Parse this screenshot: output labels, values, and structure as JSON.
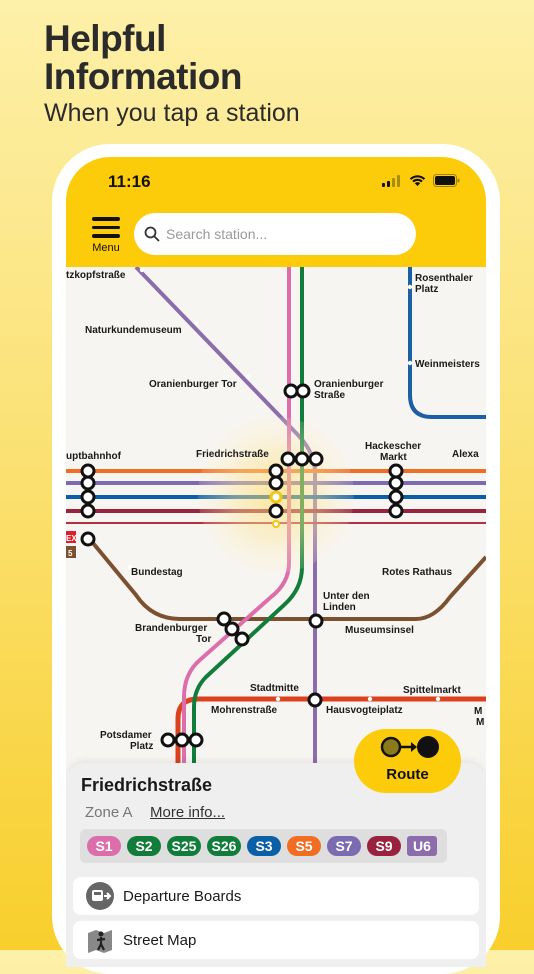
{
  "headline": {
    "line1": "Helpful",
    "line2": "Information",
    "sub": "When you tap a station"
  },
  "status": {
    "time": "11:16"
  },
  "appbar": {
    "menu_label": "Menu",
    "search_placeholder": "Search station..."
  },
  "map": {
    "stations": {
      "kopf": "tzkopfstraße",
      "natur": "Naturkundemuseum",
      "oranTor": "Oranienburger Tor",
      "oranStr1": "Oranienburger",
      "oranStr2": "Straße",
      "rosen1": "Rosenthaler",
      "rosen2": "Platz",
      "weinm": "Weinmeisters",
      "friedrich": "Friedrichstraße",
      "hack1": "Hackescher",
      "hack2": "Markt",
      "alex": "Alexa",
      "hbf": "uptbahnhof",
      "bundestag": "Bundestag",
      "rotes": "Rotes Rathaus",
      "unter1": "Unter den",
      "unter2": "Linden",
      "museum": "Museumsinsel",
      "brand1": "Brandenburger",
      "brand2": "Tor",
      "stadt": "Stadtmitte",
      "spittel": "Spittelmarkt",
      "mohren": "Mohrenstraße",
      "hausvogt": "Hausvogteiplatz",
      "pots1": "Potsdamer",
      "pots2": "Platz",
      "edge1": "M",
      "edge2": "M",
      "ex": "EX",
      "five": "5"
    }
  },
  "route": {
    "label": "Route"
  },
  "sheet": {
    "name": "Friedrichstraße",
    "zone": "Zone A",
    "more": "More info...",
    "lines": [
      {
        "label": "S1",
        "color": "#db6eab",
        "w": 34
      },
      {
        "label": "S2",
        "color": "#127d3a",
        "w": 34
      },
      {
        "label": "S25",
        "color": "#127d3a",
        "w": 34
      },
      {
        "label": "S26",
        "color": "#127d3a",
        "w": 34
      },
      {
        "label": "S3",
        "color": "#0a5fa6",
        "w": 34
      },
      {
        "label": "S5",
        "color": "#f06d22",
        "w": 34
      },
      {
        "label": "S7",
        "color": "#7b6bb1",
        "w": 34
      },
      {
        "label": "S9",
        "color": "#99223f",
        "w": 34
      },
      {
        "label": "U6",
        "color": "#8c6dab",
        "w": 30
      }
    ]
  },
  "actions": {
    "departures": "Departure Boards",
    "streetmap": "Street Map"
  },
  "colors": {
    "yellow": "#fccc0a",
    "s1": "#db6eab",
    "s2": "#127d3a",
    "s3": "#0a5fa6",
    "s5": "#f06d22",
    "s7": "#7b6bb1",
    "s9": "#99223f",
    "u6": "#8c6dab",
    "u5": "#7d5130",
    "u2": "#da421e"
  }
}
